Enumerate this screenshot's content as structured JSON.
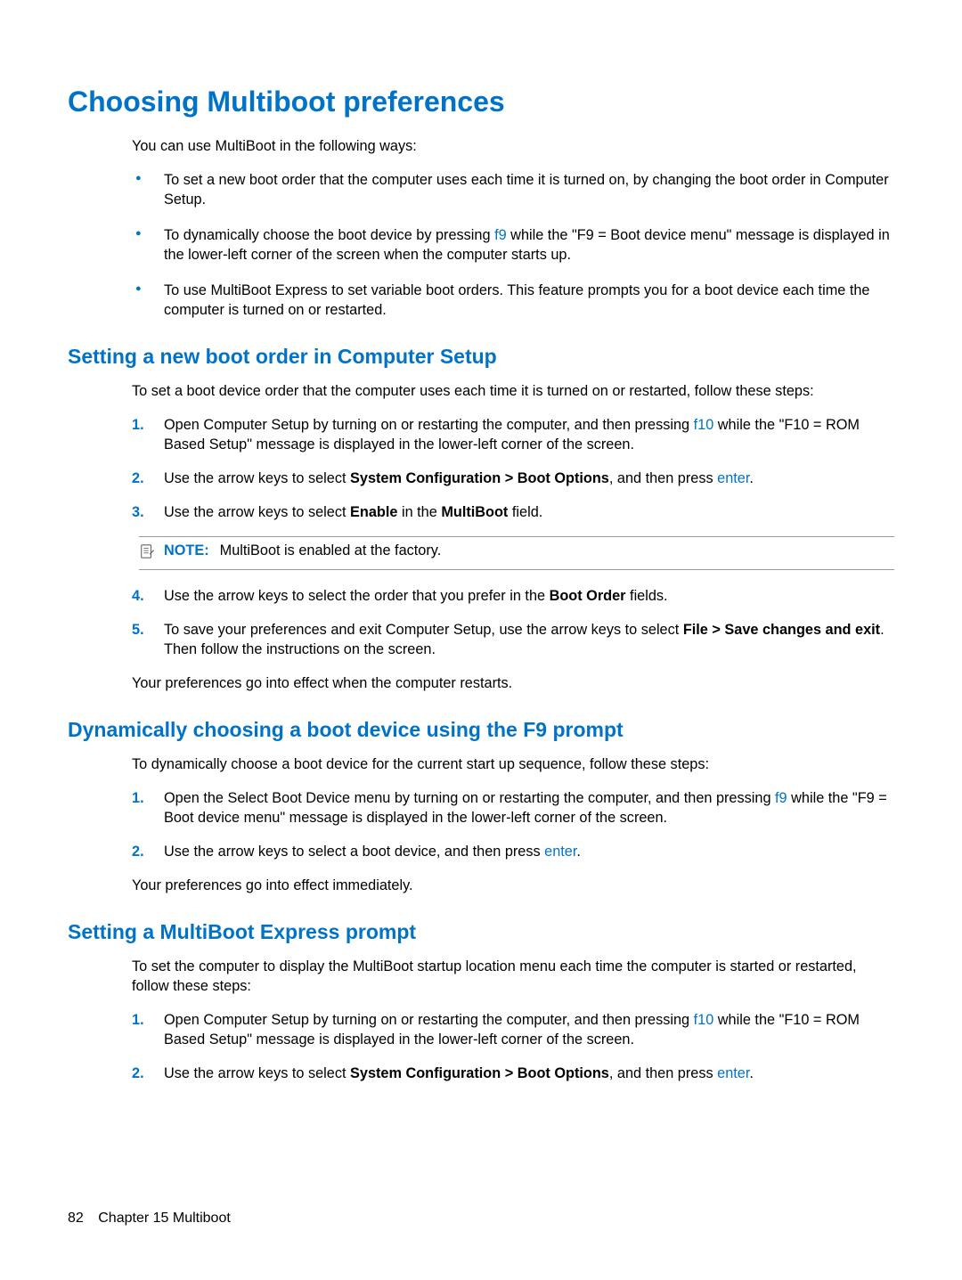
{
  "title": "Choosing Multiboot preferences",
  "intro": "You can use MultiBoot in the following ways:",
  "bullets": [
    {
      "pre": "To set a new boot order that the computer uses each time it is turned on, by changing the boot order in Computer Setup."
    },
    {
      "pre": "To dynamically choose the boot device by pressing ",
      "key": "f9",
      "post": " while the \"F9 = Boot device menu\" message is displayed in the lower-left corner of the screen when the computer starts up."
    },
    {
      "pre": "To use MultiBoot Express to set variable boot orders. This feature prompts you for a boot device each time the computer is turned on or restarted."
    }
  ],
  "section1": {
    "title": "Setting a new boot order in Computer Setup",
    "intro": "To set a boot device order that the computer uses each time it is turned on or restarted, follow these steps:",
    "steps": {
      "s1_pre": "Open Computer Setup by turning on or restarting the computer, and then pressing ",
      "s1_key": "f10",
      "s1_post": " while the \"F10 = ROM Based Setup\" message is displayed in the lower-left corner of the screen.",
      "s2_pre": "Use the arrow keys to select ",
      "s2_bold": "System Configuration > Boot Options",
      "s2_mid": ", and then press ",
      "s2_key": "enter",
      "s2_post": ".",
      "s3_pre": "Use the arrow keys to select ",
      "s3_bold1": "Enable",
      "s3_mid": " in the ",
      "s3_bold2": "MultiBoot",
      "s3_post": " field.",
      "s4_pre": "Use the arrow keys to select the order that you prefer in the ",
      "s4_bold": "Boot Order",
      "s4_post": " fields.",
      "s5_pre": "To save your preferences and exit Computer Setup, use the arrow keys to select ",
      "s5_bold": "File > Save changes and exit",
      "s5_post": ". Then follow the instructions on the screen."
    },
    "note_label": "NOTE:",
    "note_text": "MultiBoot is enabled at the factory.",
    "outro": "Your preferences go into effect when the computer restarts."
  },
  "section2": {
    "title": "Dynamically choosing a boot device using the F9 prompt",
    "intro": "To dynamically choose a boot device for the current start up sequence, follow these steps:",
    "steps": {
      "s1_pre": "Open the Select Boot Device menu by turning on or restarting the computer, and then pressing ",
      "s1_key": "f9",
      "s1_post": " while the \"F9 = Boot device menu\" message is displayed in the lower-left corner of the screen.",
      "s2_pre": "Use the arrow keys to select a boot device, and then press ",
      "s2_key": "enter",
      "s2_post": "."
    },
    "outro": "Your preferences go into effect immediately."
  },
  "section3": {
    "title": "Setting a MultiBoot Express prompt",
    "intro": "To set the computer to display the MultiBoot startup location menu each time the computer is started or restarted, follow these steps:",
    "steps": {
      "s1_pre": "Open Computer Setup by turning on or restarting the computer, and then pressing ",
      "s1_key": "f10",
      "s1_post": " while the \"F10 = ROM Based Setup\" message is displayed in the lower-left corner of the screen.",
      "s2_pre": "Use the arrow keys to select ",
      "s2_bold": "System Configuration > Boot Options",
      "s2_mid": ", and then press ",
      "s2_key": "enter",
      "s2_post": "."
    }
  },
  "footer": {
    "page": "82",
    "chapter": "Chapter 15   Multiboot"
  }
}
